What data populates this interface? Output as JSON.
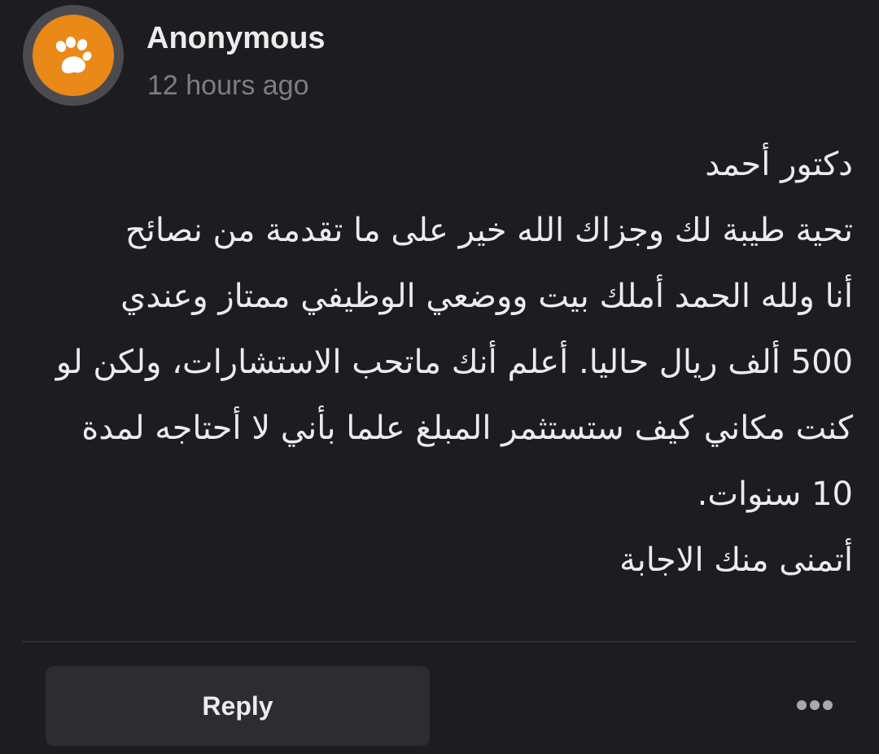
{
  "comment": {
    "author": "Anonymous",
    "timestamp": "12 hours ago",
    "avatar_icon": "paw-icon",
    "avatar_color": "#ea8818",
    "body_lines": [
      "دكتور أحمد",
      "تحية طيبة لك وجزاك الله خير على ما تقدمة من نصائح",
      "أنا ولله الحمد أملك بيت ووضعي الوظيفي ممتاز وعندي",
      "500 ألف ريال حاليا. أعلم أنك ماتحب الاستشارات، ولكن لو",
      "كنت مكاني كيف ستستثمر المبلغ علما بأني لا أحتاجه لمدة",
      "10 سنوات.",
      "أتمنى منك الاجابة"
    ]
  },
  "actions": {
    "reply_label": "Reply",
    "more_icon": "more-horizontal-icon"
  },
  "colors": {
    "background": "#1c1c21",
    "text": "#ececec",
    "muted": "#7d7d82",
    "button": "#2c2c31"
  }
}
